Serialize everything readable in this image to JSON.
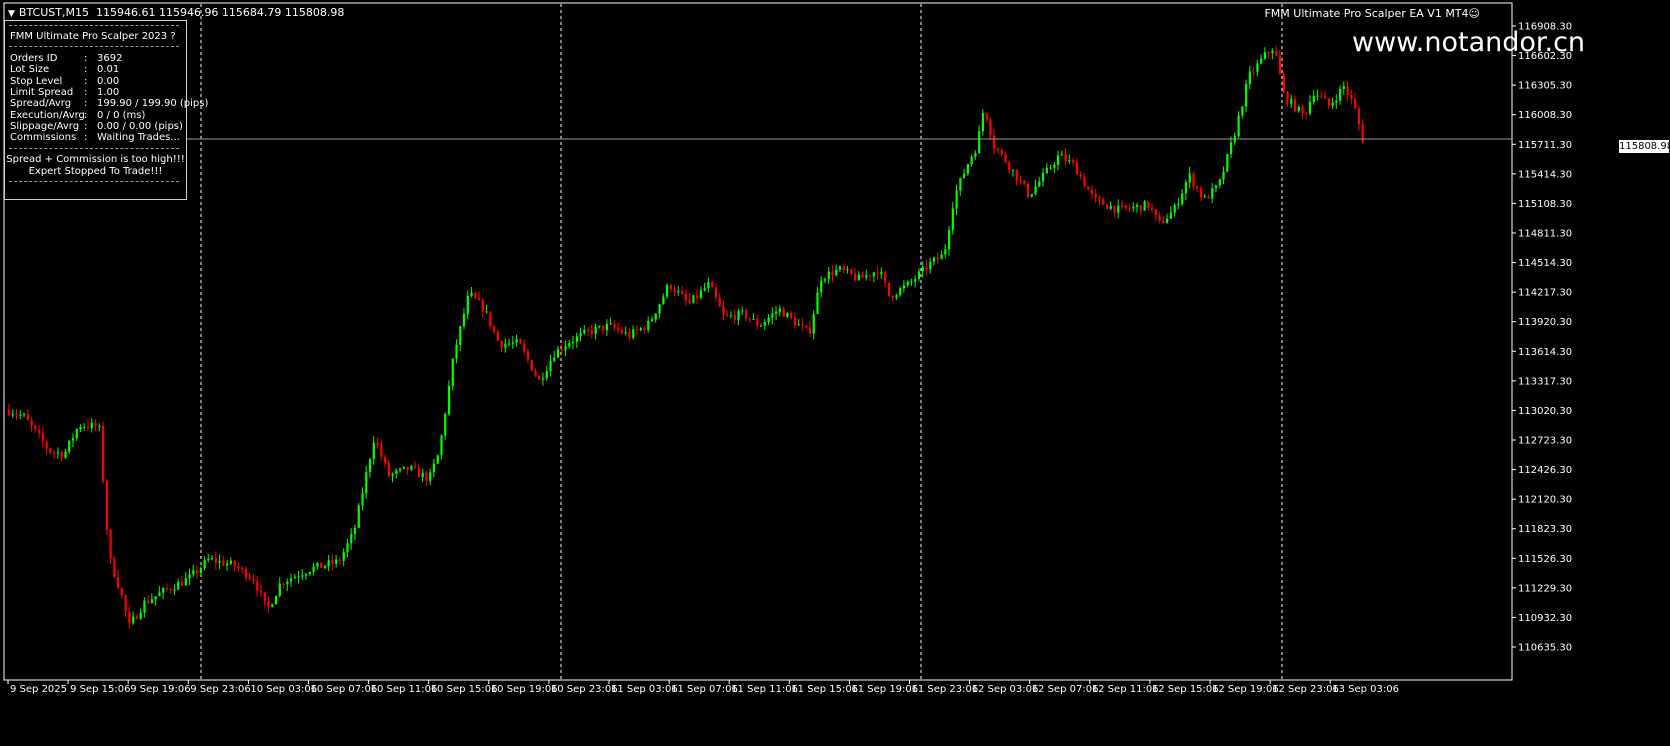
{
  "header": {
    "symbol": "BTCUST,M15",
    "ohlc": "115946.61 115946.96 115684.79 115808.98"
  },
  "ea_label": "FMM Ultimate Pro Scalper EA  V1 MT4",
  "watermark": "www.notandor.cn",
  "panel": {
    "title": "FMM Ultimate Pro Scalper 2023  ?",
    "rows": [
      {
        "key": "Orders ID",
        "value": "3692"
      },
      {
        "key": "Lot Size",
        "value": "0.01"
      },
      {
        "key": "Stop Level",
        "value": "0.00"
      },
      {
        "key": "Limit Spread",
        "value": "1.00"
      },
      {
        "key": "Spread/Avrg",
        "value": "199.90 / 199.90 (pips)"
      },
      {
        "key": "Execution/Avrg",
        "value": "0 / 0 (ms)"
      },
      {
        "key": "Slippage/Avrg",
        "value": "0.00 / 0.00 (pips)"
      },
      {
        "key": "Commissions",
        "value": "Waiting Trades..."
      }
    ],
    "message_1": "Spread + Commission is too high!!!",
    "message_2": "Expert Stopped To Trade!!!"
  },
  "current_price": "115808.98",
  "price_axis": [
    "116908.30",
    "116602.30",
    "116305.30",
    "116008.30",
    "115711.30",
    "115414.30",
    "115108.30",
    "114811.30",
    "114514.30",
    "114217.30",
    "113920.30",
    "113614.30",
    "113317.30",
    "113020.30",
    "112723.30",
    "112426.30",
    "112120.30",
    "111823.30",
    "111526.30",
    "111229.30",
    "110932.30",
    "110635.30"
  ],
  "time_axis": [
    "9 Sep 2025",
    "9 Sep 15:06",
    "9 Sep 19:06",
    "9 Sep 23:06",
    "10 Sep 03:06",
    "10 Sep 07:06",
    "10 Sep 11:06",
    "10 Sep 15:06",
    "10 Sep 19:06",
    "10 Sep 23:06",
    "11 Sep 03:06",
    "11 Sep 07:06",
    "11 Sep 11:06",
    "11 Sep 15:06",
    "11 Sep 19:06",
    "11 Sep 23:06",
    "12 Sep 03:06",
    "12 Sep 07:06",
    "12 Sep 11:06",
    "12 Sep 15:06",
    "12 Sep 19:06",
    "12 Sep 23:06",
    "13 Sep 03:06"
  ],
  "colors": {
    "bull": "#00ff00",
    "bear": "#ff0000",
    "grid": "#ffffff",
    "background": "#000000"
  },
  "chart_data": {
    "type": "candlestick",
    "series_anchors": [
      [
        0,
        113030
      ],
      [
        15,
        112960
      ],
      [
        40,
        112620
      ],
      [
        55,
        112580
      ],
      [
        70,
        112880
      ],
      [
        90,
        112860
      ],
      [
        100,
        111540
      ],
      [
        112,
        111180
      ],
      [
        120,
        110840
      ],
      [
        135,
        111080
      ],
      [
        155,
        111200
      ],
      [
        180,
        111330
      ],
      [
        200,
        111520
      ],
      [
        225,
        111460
      ],
      [
        245,
        111320
      ],
      [
        258,
        111000
      ],
      [
        272,
        111290
      ],
      [
        300,
        111420
      ],
      [
        330,
        111500
      ],
      [
        345,
        111800
      ],
      [
        365,
        112750
      ],
      [
        380,
        112360
      ],
      [
        400,
        112440
      ],
      [
        420,
        112330
      ],
      [
        430,
        112600
      ],
      [
        445,
        113600
      ],
      [
        460,
        114200
      ],
      [
        475,
        114050
      ],
      [
        490,
        113700
      ],
      [
        510,
        113700
      ],
      [
        530,
        113320
      ],
      [
        545,
        113600
      ],
      [
        560,
        113720
      ],
      [
        580,
        113820
      ],
      [
        600,
        113880
      ],
      [
        620,
        113780
      ],
      [
        640,
        113900
      ],
      [
        660,
        114300
      ],
      [
        680,
        114100
      ],
      [
        700,
        114300
      ],
      [
        715,
        113960
      ],
      [
        735,
        114000
      ],
      [
        750,
        113880
      ],
      [
        770,
        114050
      ],
      [
        790,
        113880
      ],
      [
        800,
        113800
      ],
      [
        812,
        114370
      ],
      [
        830,
        114450
      ],
      [
        850,
        114350
      ],
      [
        870,
        114450
      ],
      [
        880,
        114180
      ],
      [
        900,
        114300
      ],
      [
        920,
        114500
      ],
      [
        935,
        114600
      ],
      [
        945,
        115180
      ],
      [
        960,
        115550
      ],
      [
        968,
        115700
      ],
      [
        975,
        116100
      ],
      [
        985,
        115700
      ],
      [
        1000,
        115500
      ],
      [
        1020,
        115200
      ],
      [
        1035,
        115400
      ],
      [
        1050,
        115600
      ],
      [
        1065,
        115500
      ],
      [
        1085,
        115150
      ],
      [
        1110,
        115050
      ],
      [
        1140,
        115100
      ],
      [
        1150,
        114900
      ],
      [
        1165,
        115050
      ],
      [
        1180,
        115400
      ],
      [
        1195,
        115150
      ],
      [
        1210,
        115300
      ],
      [
        1225,
        115800
      ],
      [
        1240,
        116400
      ],
      [
        1255,
        116600
      ],
      [
        1265,
        116700
      ],
      [
        1275,
        116200
      ],
      [
        1285,
        116100
      ],
      [
        1295,
        116000
      ],
      [
        1305,
        116250
      ],
      [
        1320,
        116100
      ],
      [
        1335,
        116300
      ],
      [
        1345,
        116100
      ],
      [
        1355,
        115710
      ]
    ]
  }
}
